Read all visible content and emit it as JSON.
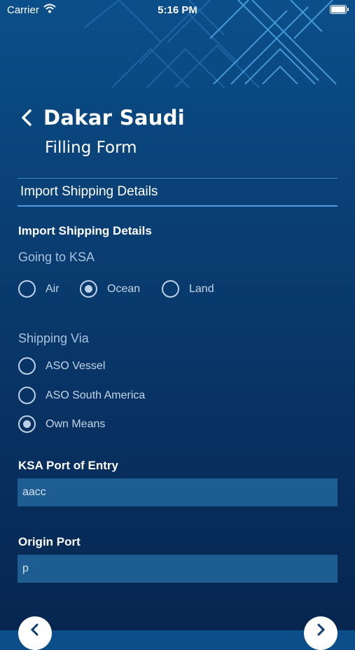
{
  "status_bar": {
    "carrier": "Carrier",
    "time": "5:16 PM",
    "icons": [
      "wifi-icon",
      "battery-icon"
    ]
  },
  "header": {
    "title": "Dakar Saudi",
    "subtitle": "Filling Form",
    "back_icon": "chevron-left-icon"
  },
  "section": {
    "title": "Import Shipping Details",
    "heading": "Import Shipping Details"
  },
  "going_to_ksa": {
    "label": "Going to KSA",
    "options": [
      {
        "label": "Air",
        "selected": false
      },
      {
        "label": "Ocean",
        "selected": true
      },
      {
        "label": "Land",
        "selected": false
      }
    ]
  },
  "shipping_via": {
    "label": "Shipping Via",
    "options": [
      {
        "label": "ASO Vessel",
        "selected": false
      },
      {
        "label": "ASO South America",
        "selected": false
      },
      {
        "label": "Own Means",
        "selected": true
      }
    ]
  },
  "ksa_port": {
    "label": "KSA Port of Entry",
    "value": "aacc"
  },
  "origin_port": {
    "label": "Origin Port",
    "value": "p"
  },
  "navigation": {
    "prev_icon": "chevron-left-icon",
    "next_icon": "chevron-right-icon"
  },
  "colors": {
    "background_top": "#0b4f8a",
    "background_bottom": "#062650",
    "accent_line": "#4a9be0",
    "field_background": "#1e5d92"
  }
}
